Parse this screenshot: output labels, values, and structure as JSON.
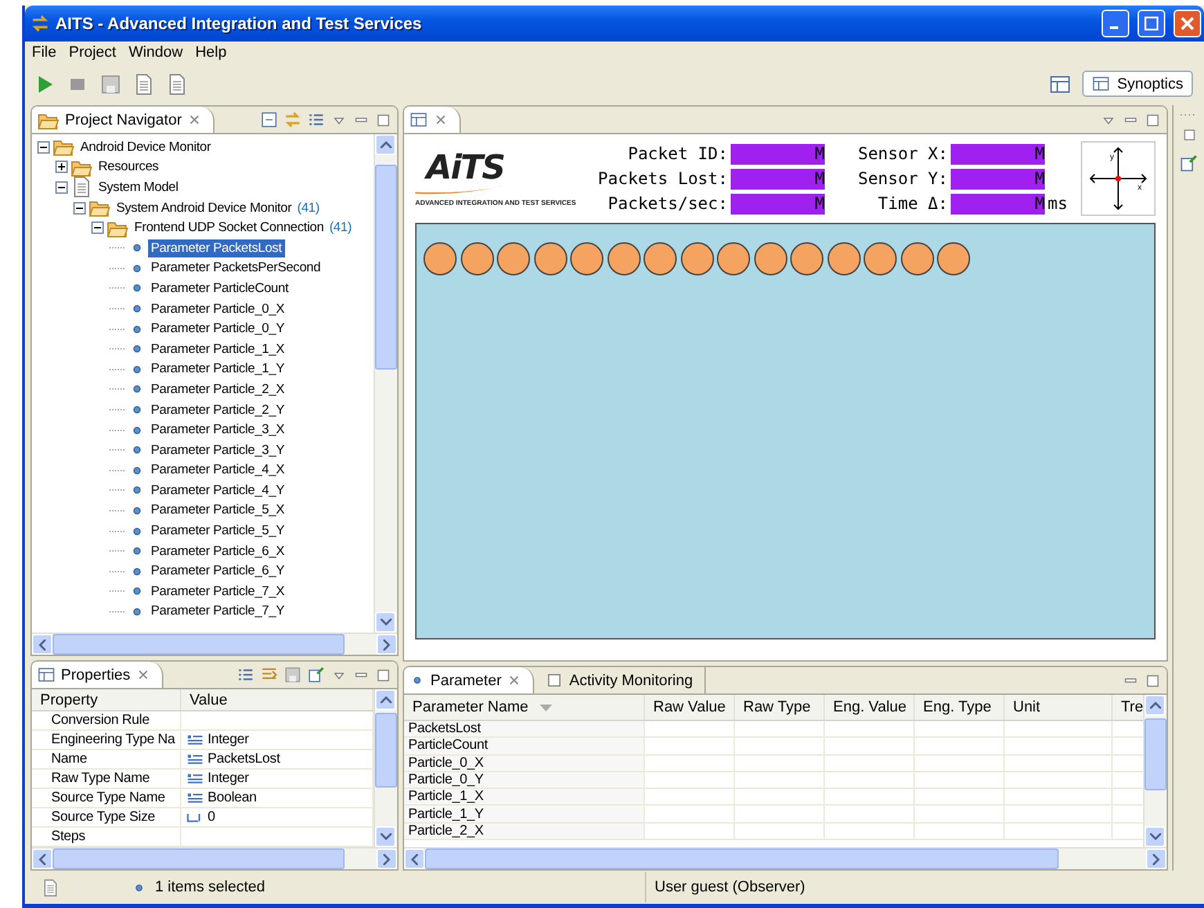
{
  "window": {
    "title": "AITS - Advanced Integration and Test Services"
  },
  "menu": [
    {
      "label": "File"
    },
    {
      "label": "Project"
    },
    {
      "label": "Window"
    },
    {
      "label": "Help"
    }
  ],
  "perspective": {
    "label": "Synoptics",
    "selected": true
  },
  "navigator": {
    "title": "Project Navigator",
    "tree": [
      {
        "label": "Android Device Monitor",
        "kind": "folder",
        "expanded": true,
        "children": [
          {
            "label": "Resources",
            "kind": "folder",
            "expanded": false
          },
          {
            "label": "System Model",
            "kind": "document",
            "expanded": true,
            "children": [
              {
                "label": "System Android Device Monitor",
                "count": "(41)",
                "kind": "folder",
                "expanded": true,
                "children": [
                  {
                    "label": "Frontend UDP Socket Connection",
                    "count": "(41)",
                    "kind": "folder",
                    "expanded": true,
                    "children": [
                      {
                        "label": "Parameter PacketsLost",
                        "kind": "parameter",
                        "selected": true
                      },
                      {
                        "label": "Parameter PacketsPerSecond",
                        "kind": "parameter",
                        "selected": false
                      },
                      {
                        "label": "Parameter ParticleCount",
                        "kind": "parameter",
                        "selected": false
                      },
                      {
                        "label": "Parameter Particle_0_X",
                        "kind": "parameter",
                        "selected": false
                      },
                      {
                        "label": "Parameter Particle_0_Y",
                        "kind": "parameter",
                        "selected": false
                      },
                      {
                        "label": "Parameter Particle_1_X",
                        "kind": "parameter",
                        "selected": false
                      },
                      {
                        "label": "Parameter Particle_1_Y",
                        "kind": "parameter",
                        "selected": false
                      },
                      {
                        "label": "Parameter Particle_2_X",
                        "kind": "parameter",
                        "selected": false
                      },
                      {
                        "label": "Parameter Particle_2_Y",
                        "kind": "parameter",
                        "selected": false
                      },
                      {
                        "label": "Parameter Particle_3_X",
                        "kind": "parameter",
                        "selected": false
                      },
                      {
                        "label": "Parameter Particle_3_Y",
                        "kind": "parameter",
                        "selected": false
                      },
                      {
                        "label": "Parameter Particle_4_X",
                        "kind": "parameter",
                        "selected": false
                      },
                      {
                        "label": "Parameter Particle_4_Y",
                        "kind": "parameter",
                        "selected": false
                      },
                      {
                        "label": "Parameter Particle_5_X",
                        "kind": "parameter",
                        "selected": false
                      },
                      {
                        "label": "Parameter Particle_5_Y",
                        "kind": "parameter",
                        "selected": false
                      },
                      {
                        "label": "Parameter Particle_6_X",
                        "kind": "parameter",
                        "selected": false
                      },
                      {
                        "label": "Parameter Particle_6_Y",
                        "kind": "parameter",
                        "selected": false
                      },
                      {
                        "label": "Parameter Particle_7_X",
                        "kind": "parameter",
                        "selected": false
                      },
                      {
                        "label": "Parameter Particle_7_Y",
                        "kind": "parameter",
                        "selected": false
                      }
                    ]
                  }
                ]
              }
            ]
          }
        ]
      }
    ]
  },
  "synoptic": {
    "logo": "AiTS",
    "tagline": "ADVANCED INTEGRATION AND TEST SERVICES",
    "readouts": [
      {
        "label": "Packet ID:",
        "value": "M"
      },
      {
        "label": "Packets Lost:",
        "value": "M"
      },
      {
        "label": "Packets/sec:",
        "value": "M"
      },
      {
        "label": "Sensor X:",
        "value": "M"
      },
      {
        "label": "Sensor Y:",
        "value": "M"
      },
      {
        "label": "Time Δ:",
        "value": "M",
        "unit": "ms"
      }
    ],
    "axes": {
      "x": "x",
      "y": "y"
    },
    "particles": [
      {
        "kind": "dot"
      },
      {
        "kind": "dot"
      },
      {
        "kind": "dot"
      },
      {
        "kind": "dot"
      },
      {
        "kind": "dot"
      },
      {
        "kind": "dot"
      },
      {
        "kind": "dot"
      },
      {
        "kind": "dot"
      },
      {
        "kind": "dot"
      },
      {
        "kind": "dot"
      },
      {
        "kind": "dot"
      },
      {
        "kind": "dot"
      },
      {
        "kind": "dot"
      },
      {
        "kind": "dot"
      },
      {
        "kind": "dot"
      }
    ]
  },
  "properties": {
    "title": "Properties",
    "columns": [
      "Property",
      "Value"
    ],
    "rows": [
      {
        "property": "Conversion Rule",
        "kind": "none"
      },
      {
        "property": "Engineering Type Na",
        "value": "Integer",
        "kind": "text"
      },
      {
        "property": "Name",
        "value": "PacketsLost",
        "kind": "text"
      },
      {
        "property": "Raw Type Name",
        "value": "Integer",
        "kind": "text"
      },
      {
        "property": "Source Type Name",
        "value": "Boolean",
        "kind": "text"
      },
      {
        "property": "Source Type Size",
        "value": "0",
        "kind": "number"
      },
      {
        "property": "Steps",
        "kind": "none"
      }
    ]
  },
  "parameters": {
    "tabs": [
      {
        "label": "Parameter",
        "selected": true
      },
      {
        "label": "Activity Monitoring",
        "selected": false
      }
    ],
    "columns": [
      "Parameter Name",
      "Raw Value",
      "Raw Type",
      "Eng. Value",
      "Eng. Type",
      "Unit",
      "Tre"
    ],
    "rows": [
      "PacketsLost",
      "ParticleCount",
      "Particle_0_X",
      "Particle_0_Y",
      "Particle_1_X",
      "Particle_1_Y",
      "Particle_2_X"
    ]
  },
  "status_bar": {
    "selection": "1 items selected",
    "user": "User guest (Observer)"
  }
}
